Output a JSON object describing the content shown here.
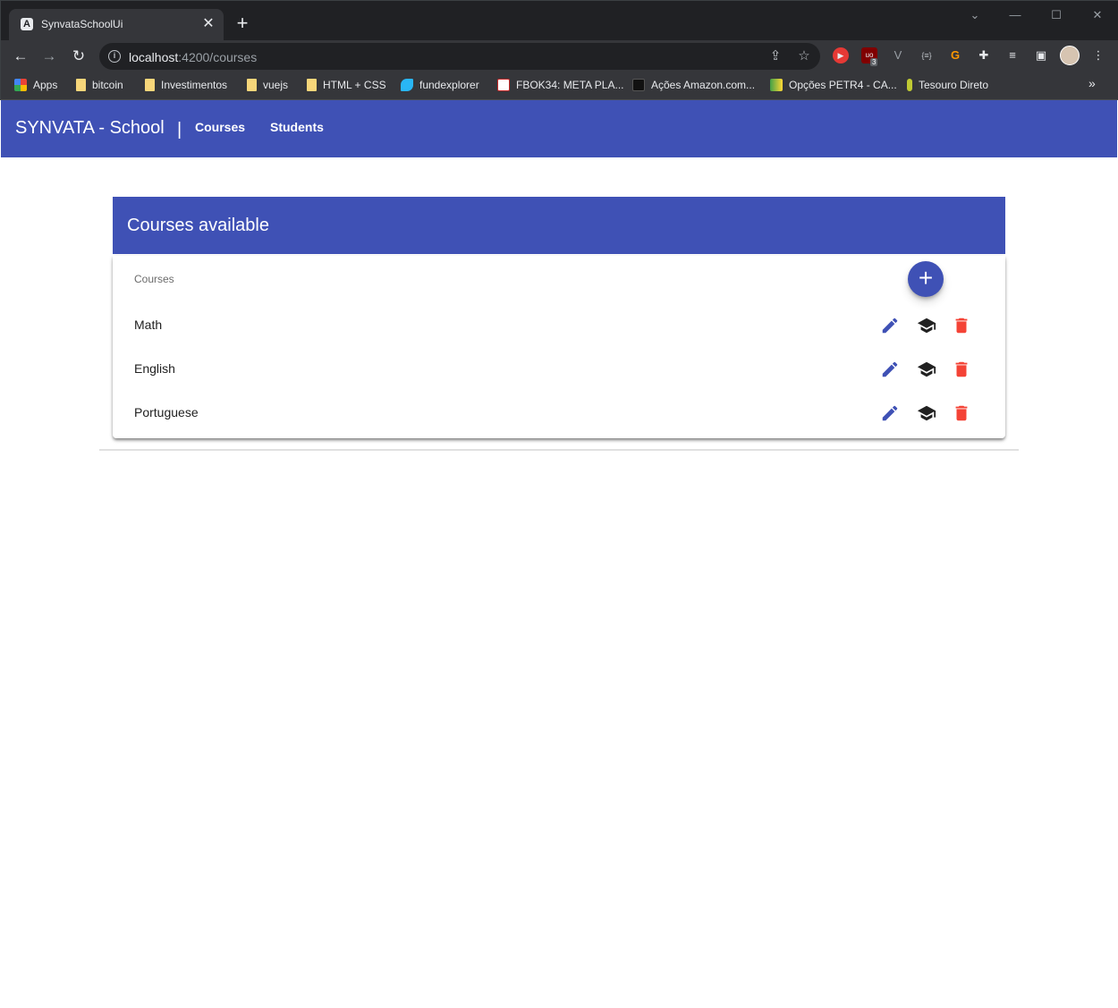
{
  "browser": {
    "tab_title": "SynvataSchoolUi",
    "tab_favicon": "A",
    "url_host": "localhost",
    "url_path": ":4200/courses",
    "bookmarks": [
      {
        "label": "Apps",
        "icon": "apps-grid-icon"
      },
      {
        "label": "bitcoin",
        "icon": "folder-icon"
      },
      {
        "label": "Investimentos",
        "icon": "folder-icon"
      },
      {
        "label": "vuejs",
        "icon": "folder-icon"
      },
      {
        "label": "HTML + CSS",
        "icon": "folder-icon"
      },
      {
        "label": "fundexplorer",
        "icon": "fundexplorer-icon"
      },
      {
        "label": "FBOK34: META PLA...",
        "icon": "statusinvest-icon"
      },
      {
        "label": "Ações Amazon.com...",
        "icon": "investing-icon"
      },
      {
        "label": "Opções PETR4 - CA...",
        "icon": "chart-icon"
      },
      {
        "label": "Tesouro Direto",
        "icon": "tesouro-icon"
      }
    ],
    "bookmarks_more": "»",
    "extension_badge": "3"
  },
  "app": {
    "brand": "SYNVATA - School",
    "divider": "|",
    "nav": [
      {
        "label": "Courses"
      },
      {
        "label": "Students"
      }
    ]
  },
  "courses": {
    "title": "Courses available",
    "column_header": "Courses",
    "add_button_glyph": "+",
    "rows": [
      {
        "name": "Math"
      },
      {
        "name": "English"
      },
      {
        "name": "Portuguese"
      }
    ]
  },
  "colors": {
    "primary": "#3f51b5",
    "edit": "#3f51b5",
    "enroll": "#212121",
    "delete": "#f44336"
  }
}
